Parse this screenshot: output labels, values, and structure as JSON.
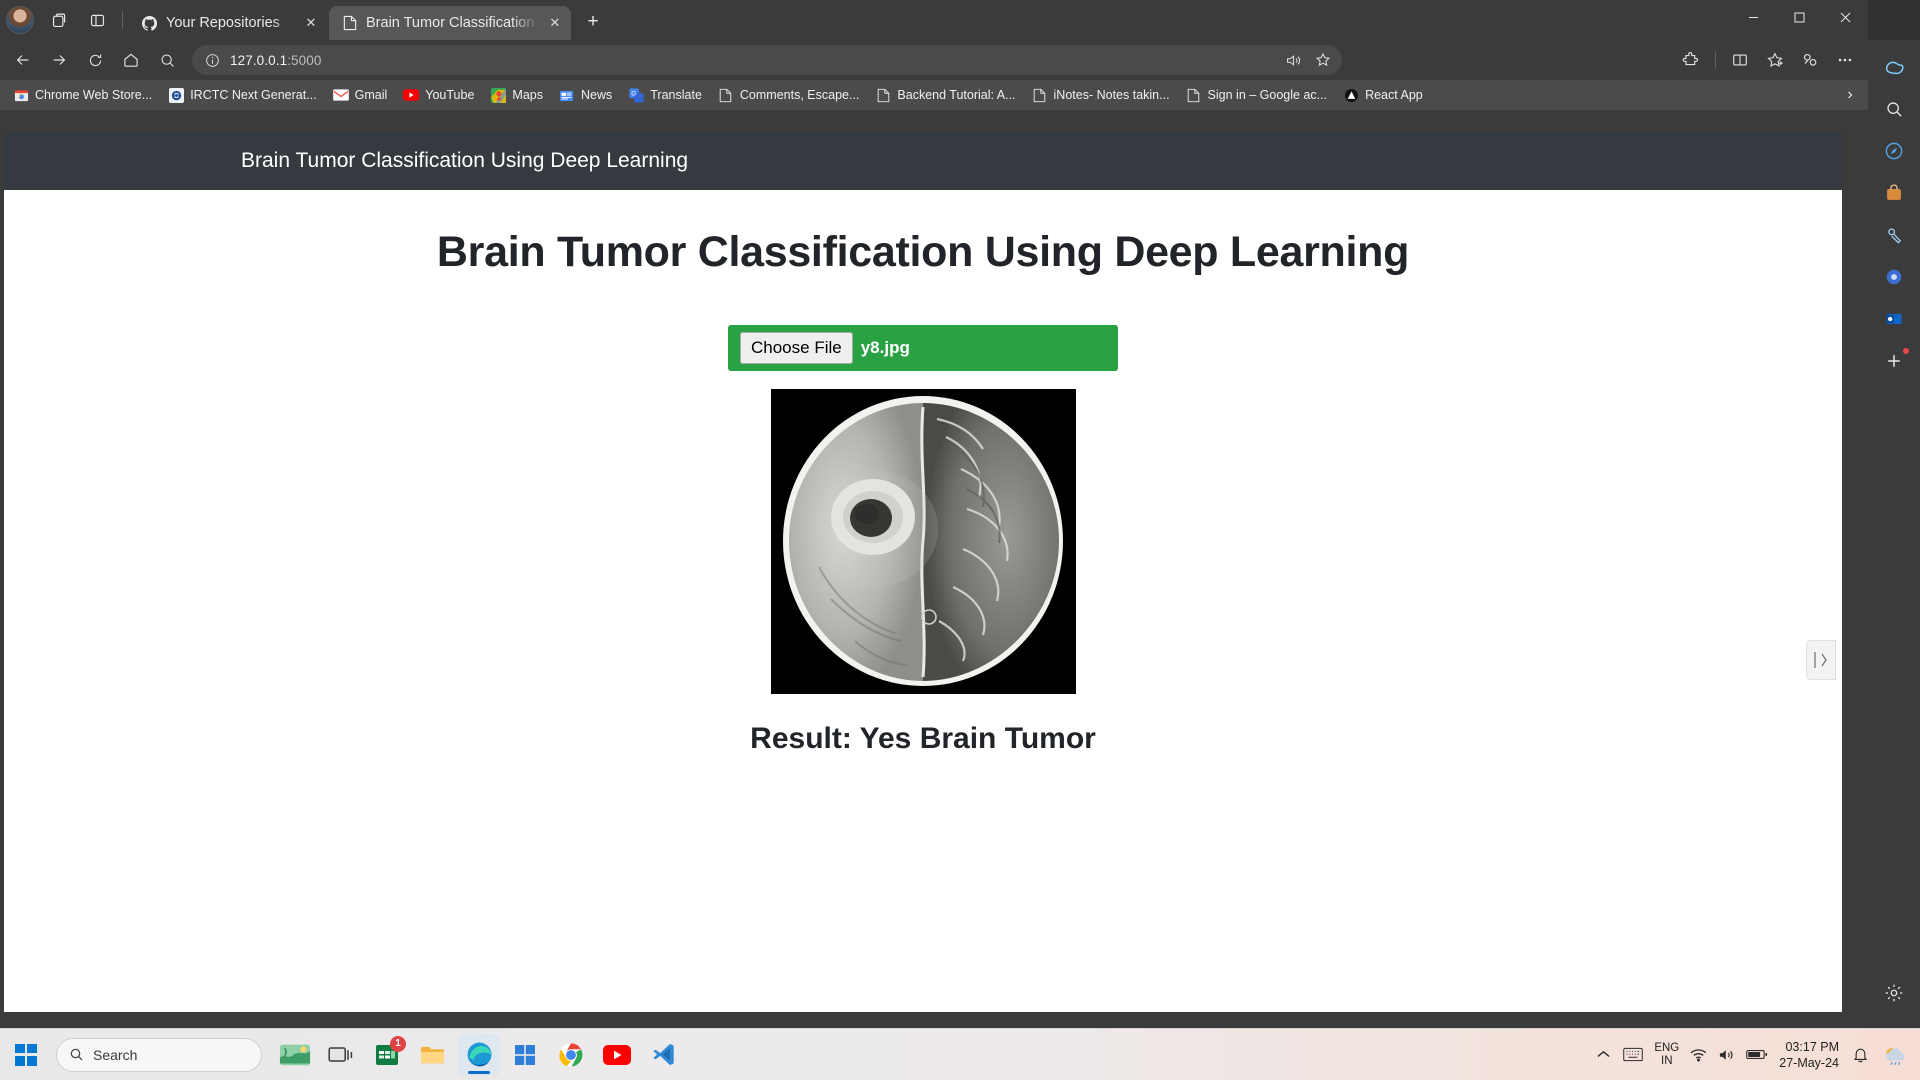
{
  "browser": {
    "tabs": [
      {
        "title": "Your Repositories",
        "favicon": "github-icon",
        "active": false
      },
      {
        "title": "Brain Tumor Classification Using",
        "favicon": "document-icon",
        "active": true
      }
    ],
    "new_tab_label": "+",
    "window_controls": {
      "minimize": "–",
      "maximize": "☐",
      "close": "✕"
    },
    "nav": {
      "back": "back-arrow-icon",
      "forward": "forward-arrow-icon",
      "refresh": "refresh-icon",
      "home": "home-icon",
      "search": "search-icon"
    },
    "omnibox": {
      "host": "127.0.0.1",
      "port": ":5000",
      "info_icon": "info-circle-icon",
      "read_aloud": "read-aloud-icon",
      "favorite": "star-icon"
    },
    "toolbar_right": [
      "extensions-icon",
      "split-screen-icon",
      "favorites-icon",
      "collections-icon",
      "settings-more-icon"
    ],
    "bookmarks": [
      {
        "label": "Chrome Web Store...",
        "icon": "chrome-web-store-icon"
      },
      {
        "label": "IRCTC Next Generat...",
        "icon": "irctc-icon"
      },
      {
        "label": "Gmail",
        "icon": "gmail-icon"
      },
      {
        "label": "YouTube",
        "icon": "youtube-icon"
      },
      {
        "label": "Maps",
        "icon": "google-maps-icon"
      },
      {
        "label": "News",
        "icon": "google-news-icon"
      },
      {
        "label": "Translate",
        "icon": "google-translate-icon"
      },
      {
        "label": "Comments, Escape...",
        "icon": "document-icon"
      },
      {
        "label": "Backend Tutorial: A...",
        "icon": "document-icon"
      },
      {
        "label": "iNotes- Notes takin...",
        "icon": "document-icon"
      },
      {
        "label": "Sign in – Google ac...",
        "icon": "document-icon"
      },
      {
        "label": "React App",
        "icon": "react-icon"
      }
    ],
    "bookmarks_overflow": "›"
  },
  "webpage": {
    "navbar_brand": "Brain Tumor Classification Using Deep Learning",
    "heading": "Brain Tumor Classification Using Deep Learning",
    "upload": {
      "choose_file_label": "Choose File",
      "file_name": "y8.jpg",
      "background_color": "#2aa244"
    },
    "image_alt": "brain-mri-scan",
    "result_text": "Result: Yes Brain Tumor",
    "edge_widget_icon": "split-screen-preview-icon"
  },
  "edge_sidebar": [
    {
      "name": "copilot-icon",
      "glyph": "◈"
    },
    {
      "name": "search-icon",
      "glyph": "⌕"
    },
    {
      "name": "discover-icon",
      "glyph": "◔"
    },
    {
      "name": "shopping-icon",
      "glyph": "▤"
    },
    {
      "name": "tools-icon",
      "glyph": "⚙"
    },
    {
      "name": "games-icon",
      "glyph": "◉"
    },
    {
      "name": "outlook-icon",
      "glyph": "✉"
    },
    {
      "name": "add-tool-icon",
      "glyph": "+"
    },
    {
      "name": "settings-icon",
      "glyph": "⚙"
    }
  ],
  "taskbar": {
    "start_label": "start-button",
    "search_placeholder": "Search",
    "apps": [
      {
        "name": "widgets-icon",
        "badge": null,
        "active": false
      },
      {
        "name": "task-view-icon",
        "badge": null,
        "active": false
      },
      {
        "name": "excel-icon",
        "badge": "1",
        "active": false
      },
      {
        "name": "file-explorer-icon",
        "badge": null,
        "active": false
      },
      {
        "name": "microsoft-edge-icon",
        "badge": null,
        "active": true
      },
      {
        "name": "microsoft-store-icon",
        "badge": null,
        "active": false
      },
      {
        "name": "google-chrome-icon",
        "badge": null,
        "active": false
      },
      {
        "name": "youtube-icon",
        "badge": null,
        "active": false
      },
      {
        "name": "vs-code-icon",
        "badge": null,
        "active": false
      }
    ],
    "tray": {
      "show_hidden": "chevron-up-icon",
      "keyboard": "touch-keyboard-icon",
      "language_line1": "ENG",
      "language_line2": "IN",
      "wifi": "wifi-icon",
      "volume": "volume-icon",
      "battery": "battery-icon",
      "time": "03:17 PM",
      "date": "27-May-24",
      "notifications": "notification-bell-icon",
      "weather": "weather-icon"
    }
  }
}
